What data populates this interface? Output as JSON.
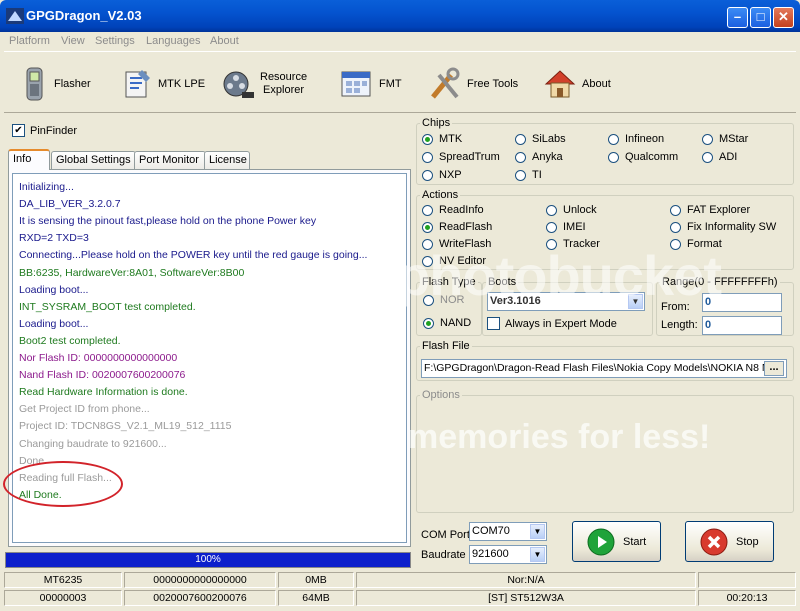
{
  "window": {
    "title": "GPGDragon_V2.03",
    "icon": "app-icon"
  },
  "menu": [
    "Platform",
    "View",
    "Settings",
    "Languages",
    "About"
  ],
  "toolbar": [
    {
      "label": "Flasher",
      "icon": "phone-icon"
    },
    {
      "label": "MTK LPE",
      "icon": "document-icon"
    },
    {
      "label": "Resource\nExplorer",
      "icon": "film-reel-icon"
    },
    {
      "label": "FMT",
      "icon": "calendar-icon"
    },
    {
      "label": "Free Tools",
      "icon": "tools-icon"
    },
    {
      "label": "About",
      "icon": "house-icon"
    }
  ],
  "pinfinder": {
    "label": "PinFinder",
    "checked": true
  },
  "tabs": [
    "Info",
    "Global Settings",
    "Port Monitor",
    "License"
  ],
  "log": [
    {
      "text": "Initializing...",
      "color": "#1a1a8c"
    },
    {
      "text": "DA_LIB_VER_3.2.0.7",
      "color": "#1a1a8c"
    },
    {
      "text": "It is sensing the pinout fast,please hold on the phone Power key",
      "color": "#1a1a8c"
    },
    {
      "text": "RXD=2  TXD=3",
      "color": "#1a1a8c"
    },
    {
      "text": "Connecting...Please hold on the POWER key until the red gauge is going...",
      "color": "#1a1a8c"
    },
    {
      "text": "BB:6235,    HardwareVer:8A01,    SoftwareVer:8B00",
      "color": "#1e7a1e"
    },
    {
      "text": "Loading boot...",
      "color": "#1a1a8c"
    },
    {
      "text": "INT_SYSRAM_BOOT test completed.",
      "color": "#1e7a1e"
    },
    {
      "text": "Loading boot...",
      "color": "#1a1a8c"
    },
    {
      "text": "Boot2 test completed.",
      "color": "#1e7a1e"
    },
    {
      "text": "Nor Flash ID: 0000000000000000",
      "color": "#8c1a8c"
    },
    {
      "text": "Nand Flash ID: 0020007600200076",
      "color": "#8c1a8c"
    },
    {
      "text": "Read Hardware Information is done.",
      "color": "#1e7a1e"
    },
    {
      "text": "Get Project ID from phone...",
      "color": "#9a9a9a"
    },
    {
      "text": "Project ID: TDCN8GS_V2.1_ML19_512_1115",
      "color": "#9a9a9a"
    },
    {
      "text": "Changing baudrate to 921600...",
      "color": "#9a9a9a"
    },
    {
      "text": "Done.",
      "color": "#9a9a9a"
    },
    {
      "text": "Reading full Flash...",
      "color": "#9a9a9a"
    },
    {
      "text": "All Done.",
      "color": "#1e7a1e"
    }
  ],
  "progress": {
    "text": "100%",
    "percent": 100
  },
  "chips": {
    "label": "Chips",
    "options": [
      "MTK",
      "SiLabs",
      "Infineon",
      "MStar",
      "SpreadTrum",
      "Anyka",
      "Qualcomm",
      "ADI",
      "NXP",
      "TI"
    ],
    "selected": "MTK"
  },
  "actions": {
    "label": "Actions",
    "options": [
      "ReadInfo",
      "Unlock",
      "FAT Explorer",
      "ReadFlash",
      "IMEI",
      "Fix Informality SW",
      "WriteFlash",
      "Tracker",
      "Format",
      "NV Editor"
    ],
    "selected": "ReadFlash"
  },
  "flash_type": {
    "label": "Flash Type",
    "options": [
      "NOR",
      "NAND"
    ],
    "selected": "NAND"
  },
  "boots": {
    "label": "Boots",
    "value": "Ver3.1016",
    "expert_label": "Always in Expert Mode",
    "expert_checked": false
  },
  "range": {
    "label": "Range(0 - FFFFFFFFh)",
    "from_label": "From:",
    "from_value": "0",
    "length_label": "Length:",
    "length_value": "0"
  },
  "flash_file": {
    "label": "Flash File",
    "path": "F:\\GPGDragon\\Dragon-Read Flash Files\\Nokia Copy Models\\NOKIA N8 N",
    "browse": "..."
  },
  "options": {
    "label": "Options"
  },
  "com": {
    "port_label": "COM Port",
    "port_value": "COM70",
    "baud_label": "Baudrate",
    "baud_value": "921600"
  },
  "buttons": {
    "start": "Start",
    "stop": "Stop"
  },
  "status": {
    "row1": [
      "MT6235",
      "0000000000000000",
      "0MB",
      "Nor:N/A",
      "",
      ""
    ],
    "row2": [
      "00000003",
      "0020007600200076",
      "64MB",
      "[ST] ST512W3A",
      "",
      "00:20:13"
    ]
  },
  "watermark": {
    "text1": "photobucket",
    "text2": "memories for less!"
  },
  "colors": {
    "title_bar": "#0453cf",
    "progress": "#0d1fcc",
    "annotation": "#d2232a"
  }
}
